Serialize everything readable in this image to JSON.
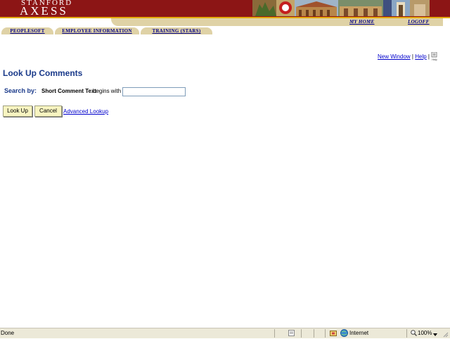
{
  "header": {
    "logo_top": "STANFORD",
    "logo_main": "AXESS"
  },
  "utility_links": {
    "my_home": "MY HOME",
    "logoff": "LOGOFF"
  },
  "tabs": [
    {
      "label": "PEOPLESOFT"
    },
    {
      "label": "EMPLOYEE INFORMATION"
    },
    {
      "label": "TRAINING (STARS)"
    }
  ],
  "page_links": {
    "new_window": "New Window",
    "separator": "|",
    "help": "Help",
    "help_icon_text": "Help"
  },
  "page": {
    "title": "Look Up Comments",
    "search_by": "Search by:",
    "field_label": "Short Comment Text",
    "operator": "begins with",
    "search_value": "",
    "look_up_button": "Look Up",
    "cancel_button": "Cancel",
    "advanced_lookup": "Advanced Lookup"
  },
  "status_bar": {
    "status": "Done",
    "zone": "Internet",
    "zoom": "100%"
  },
  "colors": {
    "banner": "#8c1515",
    "tab": "#dfd2a6",
    "title": "#1a3a8a",
    "button": "#f7f4c0"
  }
}
